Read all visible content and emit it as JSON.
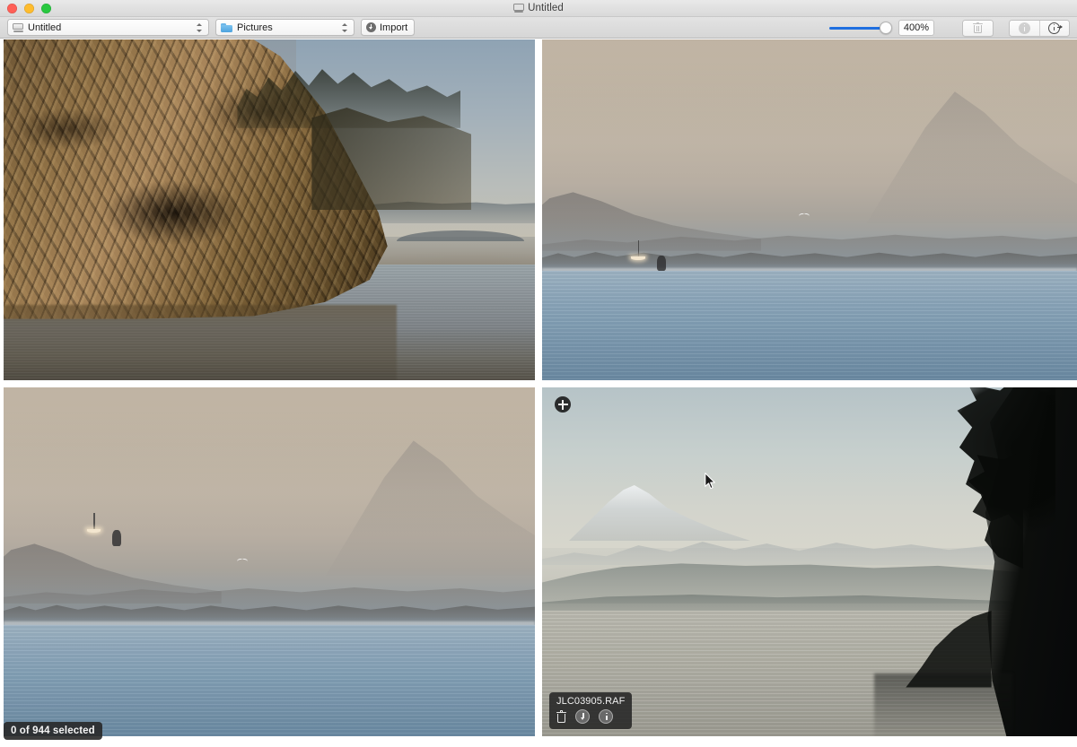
{
  "window": {
    "title": "Untitled",
    "title_icon": "disk-icon",
    "traffic_lights": [
      "close",
      "minimize",
      "zoom"
    ]
  },
  "toolbar": {
    "volume_popup": {
      "label": "Untitled",
      "icon": "drive-icon"
    },
    "folder_popup": {
      "label": "Pictures",
      "icon": "folder-icon"
    },
    "import_button": {
      "label": "Import",
      "icon": "download-circle-icon"
    },
    "zoom_slider": {
      "value": 100,
      "min": 0,
      "max": 100
    },
    "zoom_field": {
      "value": "400%"
    },
    "actions": [
      {
        "name": "delete",
        "icon": "trash-icon",
        "enabled": false
      },
      {
        "name": "info",
        "icon": "info-filled-icon",
        "enabled": false
      },
      {
        "name": "info-inspector",
        "icon": "info-arrow-icon",
        "enabled": true
      }
    ]
  },
  "status": {
    "selection_badge": "0 of 944 selected"
  },
  "grid": {
    "photos": [
      {
        "id": "photo-1",
        "scene": "golden-rock-cliff-over-water"
      },
      {
        "id": "photo-2",
        "scene": "hazy-seascape-with-sailboat"
      },
      {
        "id": "photo-3",
        "scene": "hazy-seascape-with-sailboat-and-gull"
      },
      {
        "id": "photo-4",
        "scene": "misty-mountain-across-calm-water-with-tree-silhouette"
      }
    ]
  },
  "hover_overlay": {
    "filename": "JLC03905.RAF",
    "add_badge_icon": "plus-circle-icon",
    "buttons": [
      {
        "name": "delete",
        "icon": "trash-icon"
      },
      {
        "name": "download",
        "icon": "arrow-down-circle-icon"
      },
      {
        "name": "info",
        "icon": "info-circle-icon"
      }
    ]
  },
  "colors": {
    "accent": "#1f6fe0",
    "toolbar_bg": "#dcdcdc",
    "badge_bg": "#282828"
  }
}
